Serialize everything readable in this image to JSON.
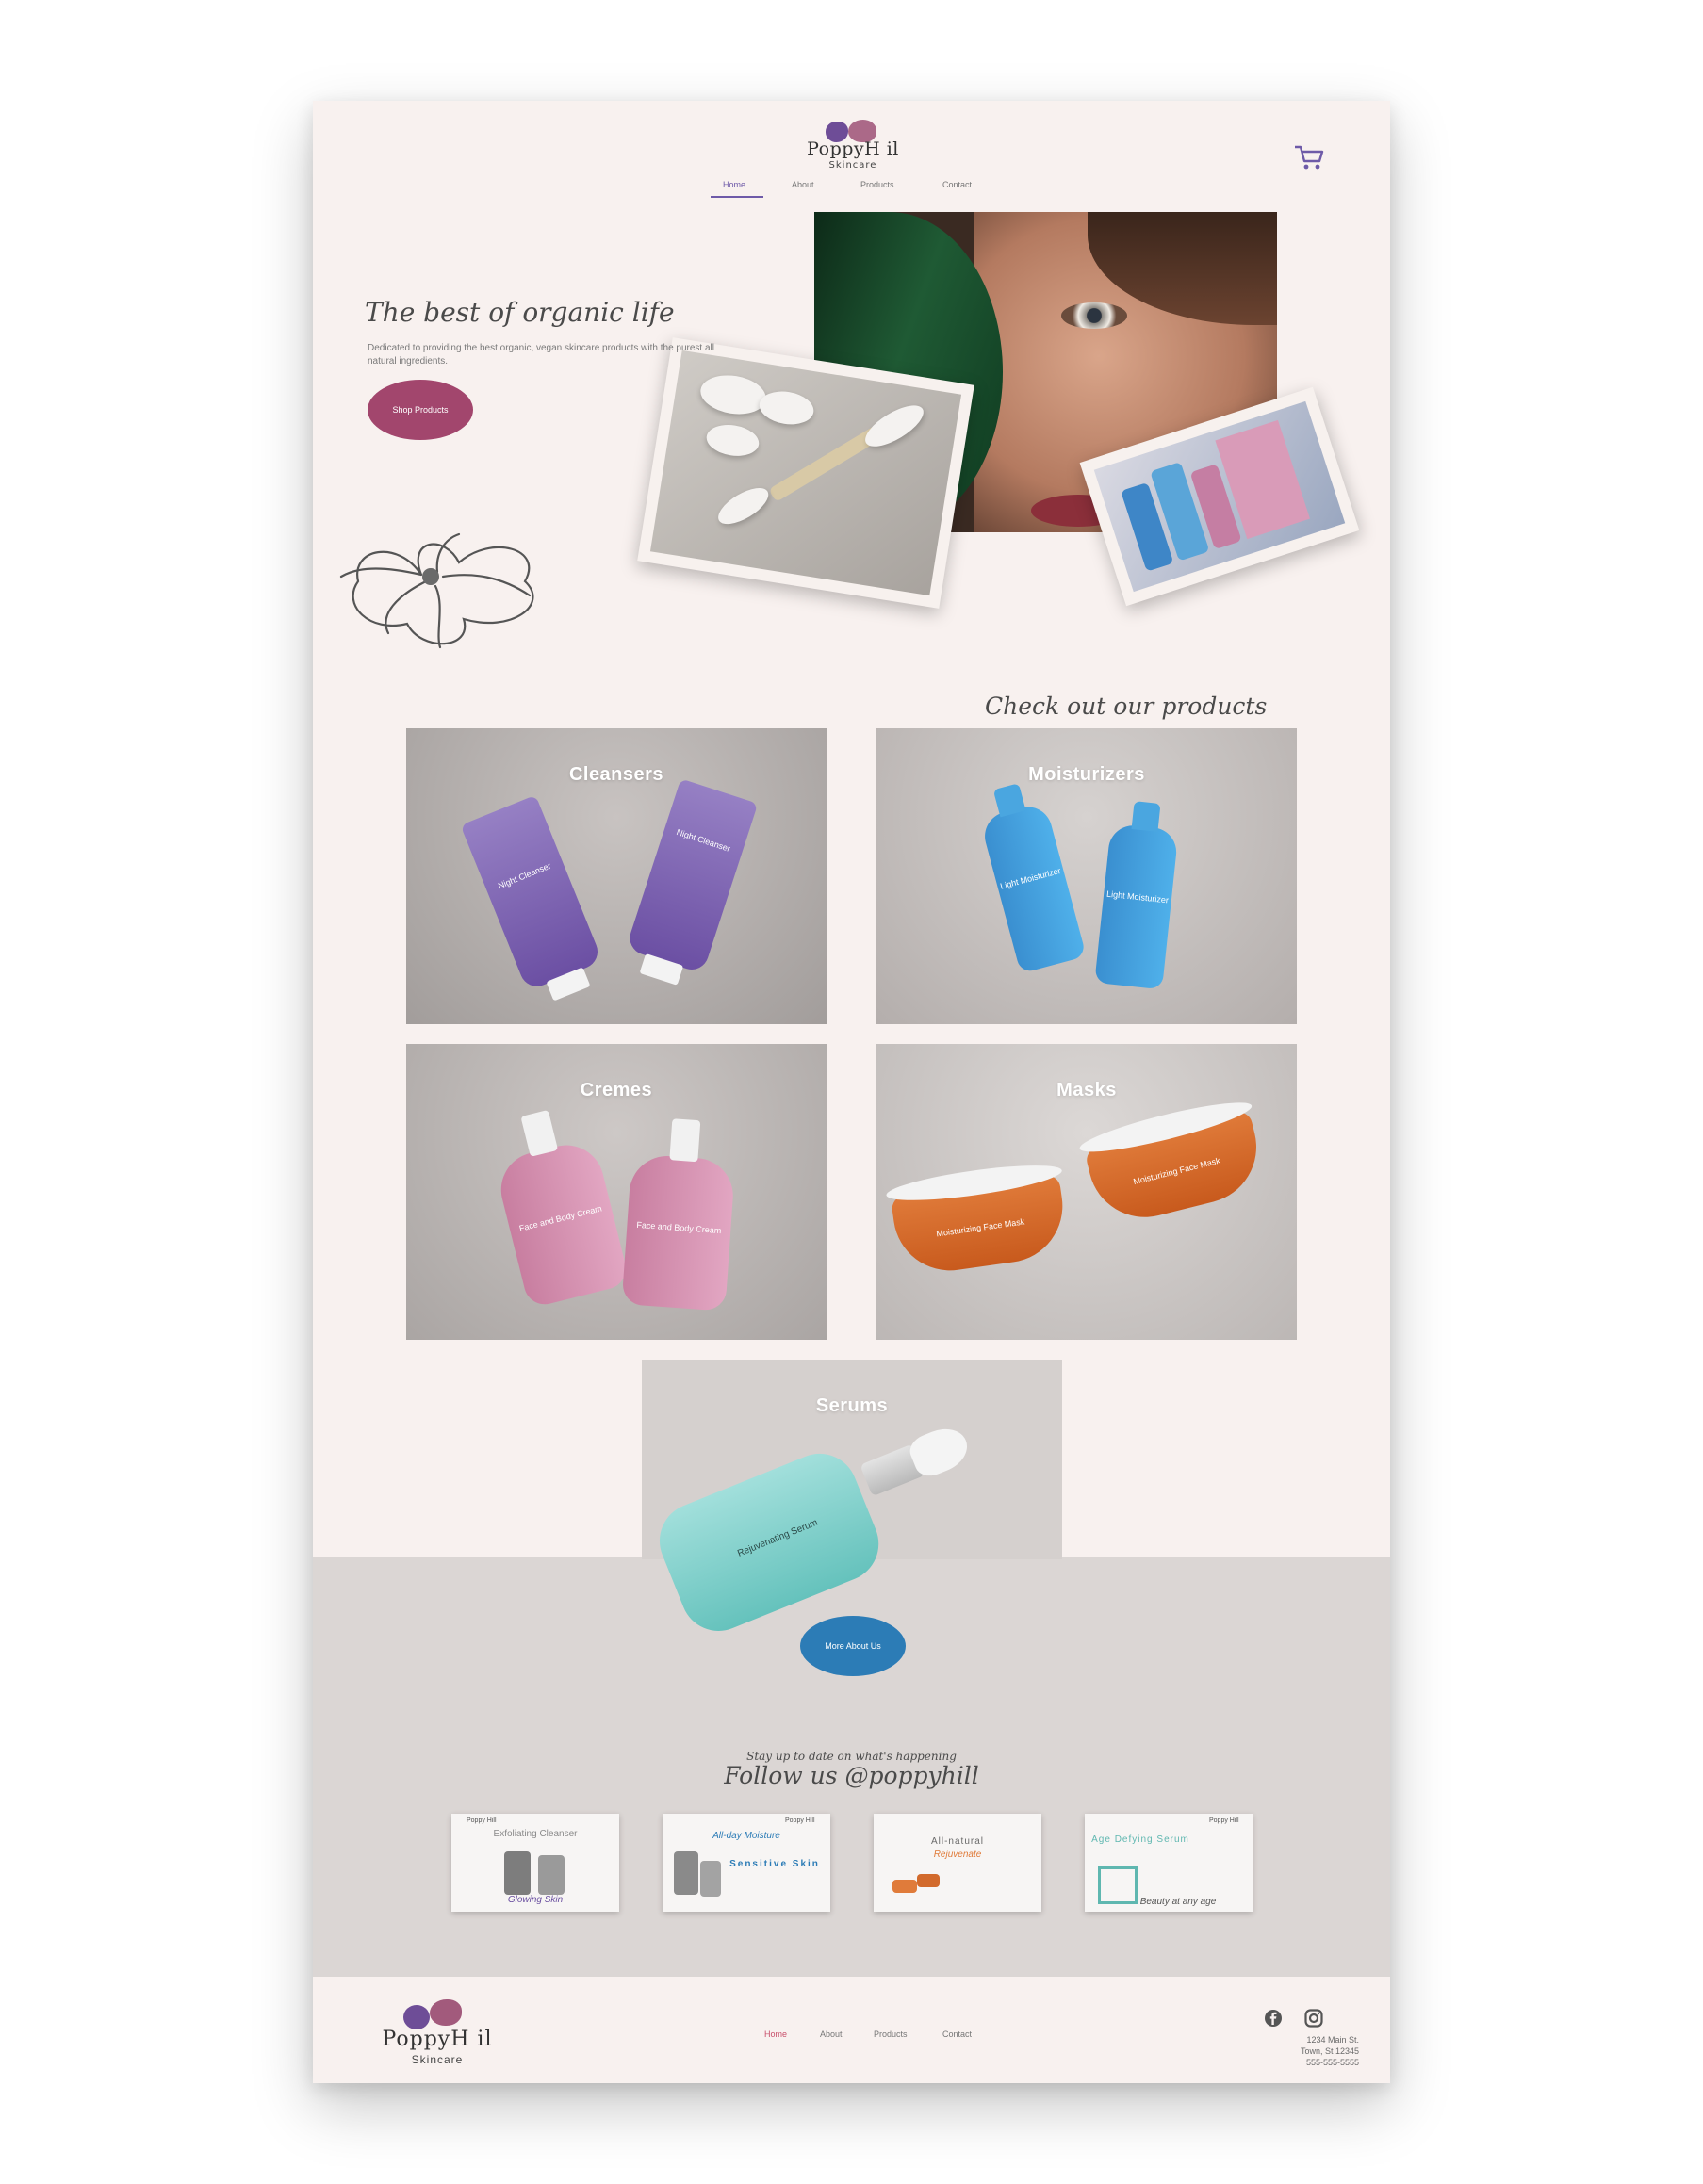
{
  "brand": {
    "name": "PoppyH il",
    "tagline": "Skincare"
  },
  "nav": {
    "items": [
      "Home",
      "About",
      "Products",
      "Contact"
    ],
    "active": "Home"
  },
  "hero": {
    "title": "The best of organic life",
    "description": "Dedicated to providing the best organic, vegan skincare products with the purest all natural ingredients.",
    "button": "Shop Products"
  },
  "products": {
    "title": "Check out our products",
    "tiles": [
      "Cleansers",
      "Moisturizers",
      "Cremes",
      "Masks",
      "Serums"
    ],
    "labels": {
      "cleanser": "Night Cleanser",
      "moisturizer": "Light Moisturizer",
      "creme": "Face and Body Cream",
      "mask": "Moisturizing Face Mask",
      "serum": "Rejuvenating Serum"
    }
  },
  "about_button": "More About Us",
  "follow": {
    "subtitle": "Stay up to date on what's happening",
    "title": "Follow us @poppyhill",
    "posts": [
      {
        "top": "Exfoliating Cleanser",
        "bottom": "Glowing Skin"
      },
      {
        "top": "All-day Moisture",
        "bottom": "Sensitive Skin"
      },
      {
        "top": "All-natural",
        "bottom": "Rejuvenate"
      },
      {
        "top": "Age Defying Serum",
        "bottom": "Beauty at any age"
      }
    ],
    "mini_brand": "Poppy Hill"
  },
  "footer": {
    "nav": [
      "Home",
      "About",
      "Products",
      "Contact"
    ],
    "address": [
      "1234 Main St.",
      "Town, St 12345",
      "555-555-5555"
    ],
    "social": [
      "facebook-icon",
      "instagram-icon"
    ]
  },
  "colors": {
    "page_bg": "#f8f1ef",
    "accent_purple": "#6e5aa8",
    "shop_button": "#a2466d",
    "about_button": "#2c7cb6",
    "gray_band": "#dbd6d4"
  }
}
